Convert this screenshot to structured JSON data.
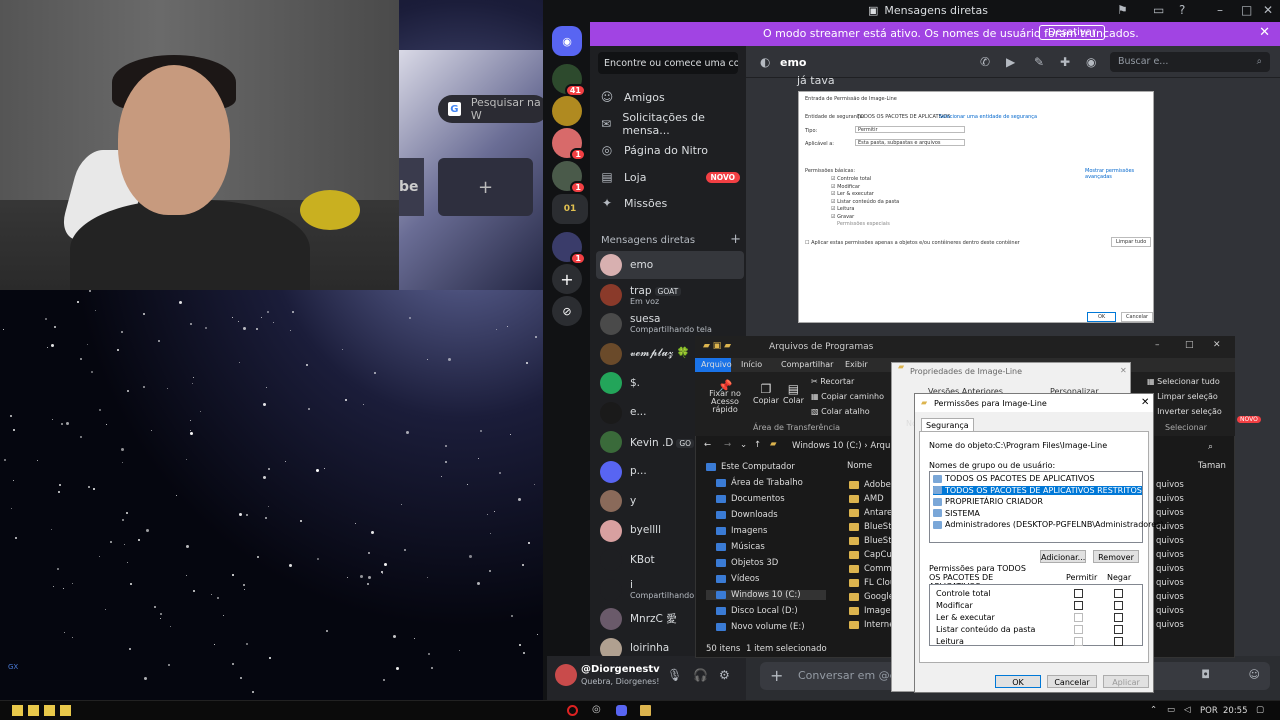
{
  "stream": {
    "google_placeholder": "Pesquisar na W",
    "tile_text": "be",
    "plus": "+"
  },
  "discord": {
    "window_title": "Mensagens diretas",
    "streamer_banner": "O modo streamer está ativo. Os nomes de usuário foram truncados.",
    "streamer_button": "Desativar",
    "search_conv": "Encontre ou comece uma conv...",
    "servers": [
      {
        "badge": "41"
      },
      {
        "badge": ""
      },
      {
        "badge": "1"
      },
      {
        "badge": "1"
      },
      {
        "badge": "01"
      },
      {
        "badge": "1"
      }
    ],
    "nav": [
      {
        "label": "Amigos",
        "icon": "friends-icon"
      },
      {
        "label": "Solicitações de mensa...",
        "icon": "mail-icon"
      },
      {
        "label": "Página do Nitro",
        "icon": "nitro-icon"
      },
      {
        "label": "Loja",
        "icon": "shop-icon",
        "badge": "NOVO"
      },
      {
        "label": "Missões",
        "icon": "quests-icon"
      }
    ],
    "dm_header": "Mensagens diretas",
    "dm_add": "+",
    "dms": [
      {
        "name": "emo",
        "sub": "",
        "tag": "",
        "color": "#d8b0b0"
      },
      {
        "name": "trap",
        "sub": "Em voz",
        "tag": "GOAT",
        "color": "#8a3a2a"
      },
      {
        "name": "suesa",
        "sub": "Compartilhando tela",
        "tag": "",
        "color": "#4a4a4a"
      },
      {
        "name": "𝓿𝓮𝓶𝓹𝓵𝓾𝔃 🍀",
        "sub": "",
        "tag": "",
        "color": "#6a4a2a"
      },
      {
        "name": "$.",
        "sub": "",
        "tag": "",
        "color": "#23a55a"
      },
      {
        "name": "e...",
        "sub": "",
        "tag": "",
        "color": "#1a1a1a"
      },
      {
        "name": "Kevin .D",
        "sub": "",
        "tag": "GO",
        "color": "#3a6a3a"
      },
      {
        "name": "p...",
        "sub": "",
        "tag": "",
        "color": "#5865f2"
      },
      {
        "name": "y",
        "sub": "",
        "tag": "",
        "color": "#8a6a5a"
      },
      {
        "name": "byellll",
        "sub": "",
        "tag": "",
        "color": "#d8a0a0"
      },
      {
        "name": "KBot",
        "sub": "",
        "tag": "",
        "color": "#1e1f22"
      },
      {
        "name": "i",
        "sub": "Compartilhando",
        "tag": "",
        "color": "#1e1f22"
      },
      {
        "name": "MnrzC 愛",
        "sub": "",
        "tag": "",
        "color": "#6a5a6a"
      },
      {
        "name": "loirinha",
        "sub": "",
        "tag": "",
        "color": "#b0a090"
      }
    ],
    "user": {
      "name": "@Diorgenestv",
      "status": "Quebra, Diorgenes!"
    },
    "chat": {
      "recipient": "emo",
      "search": "Buscar e...",
      "message": "já tava",
      "input_placeholder": "Conversar em @er"
    }
  },
  "embedded_dialog": {
    "title": "Entrada de Permissão de Image-Line",
    "principal_label": "Entidade de segurança:",
    "principal_value": "TODOS OS PACOTES DE APLICATIVOS",
    "principal_link": "Selecionar uma entidade de segurança",
    "type_label": "Tipo:",
    "type_value": "Permitir",
    "applies_label": "Aplicável a:",
    "applies_value": "Esta pasta, subpastas e arquivos",
    "basic_label": "Permissões básicas:",
    "advanced_link": "Mostrar permissões avançadas",
    "perms": [
      "Controle total",
      "Modificar",
      "Ler & executar",
      "Listar conteúdo da pasta",
      "Leitura",
      "Gravar",
      "Permissões especiais"
    ],
    "apply_text": "Aplicar estas permissões apenas a objetos e/ou contêineres dentro deste contêiner",
    "clear_all": "Limpar tudo",
    "ok": "OK",
    "cancel": "Cancelar"
  },
  "explorer": {
    "title": "Arquivos de Programas",
    "tabs": [
      "Arquivo",
      "Início",
      "Compartilhar",
      "Exibir"
    ],
    "ribbon": {
      "pin": "Fixar no Acesso rápido",
      "copy": "Copiar",
      "paste": "Colar",
      "cut": "Recortar",
      "copy_path": "Copiar caminho",
      "paste_shortcut": "Colar atalho",
      "clipboard": "Área de Transferência",
      "select_all": "Selecionar tudo",
      "clear_selection": "Limpar seleção",
      "invert_selection": "Inverter seleção",
      "select": "Selecionar",
      "novo": "NOVO"
    },
    "address": "Windows 10 (C:)  ›  Arquivo",
    "tree": [
      "Este Computador",
      "Área de Trabalho",
      "Documentos",
      "Downloads",
      "Imagens",
      "Músicas",
      "Objetos 3D",
      "Vídeos",
      "Windows 10 (C:)",
      "Disco Local (D:)",
      "Novo volume (E:)"
    ],
    "col_name": "Nome",
    "col_size": "Taman",
    "files": [
      "Adobe",
      "AMD",
      "Antares",
      "BlueStac",
      "BlueStac",
      "CapCut",
      "Commo",
      "FL Cloud",
      "Google",
      "Image-L",
      "Internet"
    ],
    "right_col": [
      "quivos",
      "quivos",
      "quivos",
      "quivos",
      "quivos",
      "quivos",
      "quivos",
      "quivos",
      "quivos",
      "quivos",
      "quivos"
    ],
    "status_items": "50 itens",
    "status_selected": "1 item selecionado"
  },
  "props": {
    "title": "Propriedades de Image-Line",
    "tab_general": "No",
    "tab_security_frag": "Versões Anteriores",
    "tab_custom_frag": "Personalizar",
    "row1": "No",
    "row2": "Pe",
    "row3": "Pa",
    "row4": "ava"
  },
  "permissions": {
    "title": "Permissões para Image-Line",
    "tab": "Segurança",
    "object_label": "Nome do objeto:",
    "object_value": "C:\\Program Files\\Image-Line",
    "groups_label": "Nomes de grupo ou de usuário:",
    "groups": [
      "TODOS OS PACOTES DE APLICATIVOS",
      "TODOS OS PACOTES DE APLICATIVOS RESTRITOS",
      "PROPRIETÁRIO CRIADOR",
      "SISTEMA",
      "Administradores (DESKTOP-PGFELNB\\Administradores)"
    ],
    "add": "Adicionar...",
    "remove": "Remover",
    "perms_for": "Permissões para TODOS OS PACOTES DE APLICATIVOS",
    "allow": "Permitir",
    "deny": "Negar",
    "perm_rows": [
      "Controle total",
      "Modificar",
      "Ler & executar",
      "Listar conteúdo da pasta",
      "Leitura"
    ],
    "ok": "OK",
    "cancel": "Cancelar",
    "apply": "Aplicar"
  },
  "taskbar": {
    "lang": "POR",
    "time": "20:55",
    "gx": "GX"
  }
}
